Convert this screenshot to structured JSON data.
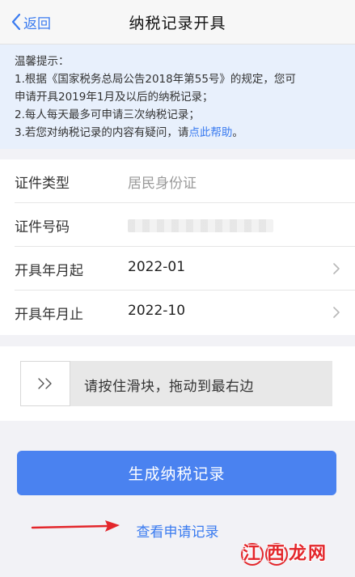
{
  "nav": {
    "back_label": "返回",
    "title": "纳税记录开具"
  },
  "notice": {
    "heading": "温馨提示：",
    "line1": "1.根据《国家税务总局公告2018年第55号》的规定，您可",
    "line2": "申请开具2019年1月及以后的纳税记录；",
    "line3": "2.每人每天最多可申请三次纳税记录；",
    "line4_prefix": "3.若您对纳税记录的内容有疑问，请",
    "line4_link": "点此帮助",
    "line4_suffix": "。"
  },
  "form": {
    "id_type_label": "证件类型",
    "id_type_value": "居民身份证",
    "id_number_label": "证件号码",
    "start_label": "开具年月起",
    "start_value": "2022-01",
    "end_label": "开具年月止",
    "end_value": "2022-10"
  },
  "slider": {
    "handle_icon": "double-chevron-right-icon",
    "text": "请按住滑块，拖动到最右边"
  },
  "actions": {
    "generate_label": "生成纳税记录",
    "history_label": "查看申请记录"
  },
  "watermark": {
    "char1": "江",
    "char2": "西",
    "char3": "龙网"
  },
  "colors": {
    "accent": "#3a7bf0",
    "button": "#4a82f0",
    "notice_bg": "#e8f0fc",
    "annotation_arrow": "#e3262b"
  }
}
